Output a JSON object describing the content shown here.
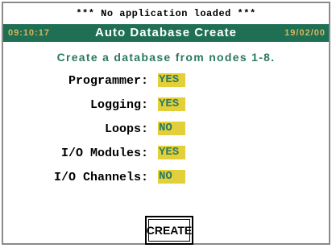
{
  "status_line": "*** No application loaded ***",
  "header": {
    "time": "09:10:17",
    "title": "Auto Database Create",
    "date": "19/02/00"
  },
  "subtitle": "Create a database from nodes 1-8.",
  "options": [
    {
      "label": "Programmer:",
      "value": "YES"
    },
    {
      "label": "Logging:",
      "value": "YES"
    },
    {
      "label": "Loops:",
      "value": "NO"
    },
    {
      "label": "I/O Modules:",
      "value": "YES"
    },
    {
      "label": "I/O Channels:",
      "value": "NO"
    }
  ],
  "create_button": "CREATE",
  "colors": {
    "title_bar": "#1e6f53",
    "accent_text": "#2a7a5c",
    "value_field": "#e3cf3a",
    "clock_text": "#d8b55a"
  }
}
